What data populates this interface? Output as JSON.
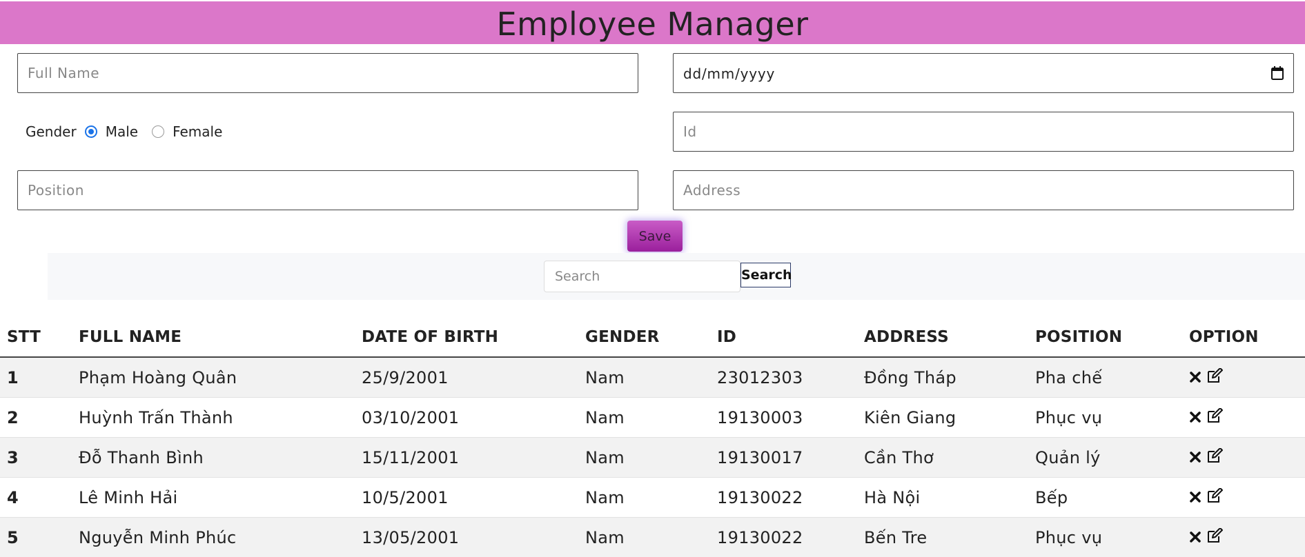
{
  "header": {
    "title": "Employee Manager"
  },
  "form": {
    "fullname_placeholder": "Full Name",
    "dob_placeholder": "dd/mm/yyyy",
    "gender_label": "Gender",
    "gender_options": [
      "Male",
      "Female"
    ],
    "gender_selected": "Male",
    "id_placeholder": "Id",
    "position_placeholder": "Position",
    "address_placeholder": "Address",
    "save_label": "Save"
  },
  "search": {
    "placeholder": "Search",
    "button_label": "Search"
  },
  "table": {
    "headers": [
      "STT",
      "FULL NAME",
      "DATE OF BIRTH",
      "GENDER",
      "ID",
      "ADDRESS",
      "POSITION",
      "OPTION"
    ],
    "rows": [
      {
        "stt": "1",
        "name": "Phạm Hoàng Quân",
        "dob": "25/9/2001",
        "gender": "Nam",
        "id": "23012303",
        "address": "Đồng Tháp",
        "position": "Pha chế"
      },
      {
        "stt": "2",
        "name": "Huỳnh Trấn Thành",
        "dob": "03/10/2001",
        "gender": "Nam",
        "id": "19130003",
        "address": "Kiên Giang",
        "position": "Phục vụ"
      },
      {
        "stt": "3",
        "name": "Đỗ Thanh Bình",
        "dob": "15/11/2001",
        "gender": "Nam",
        "id": "19130017",
        "address": "Cần Thơ",
        "position": "Quản lý"
      },
      {
        "stt": "4",
        "name": "Lê Minh Hải",
        "dob": "10/5/2001",
        "gender": "Nam",
        "id": "19130022",
        "address": "Hà Nội",
        "position": "Bếp"
      },
      {
        "stt": "5",
        "name": "Nguyễn Minh Phúc",
        "dob": "13/05/2001",
        "gender": "Nam",
        "id": "19130022",
        "address": "Bến Tre",
        "position": "Phục vụ"
      }
    ],
    "options": {
      "delete_icon": "x-icon",
      "edit_icon": "edit-icon"
    }
  },
  "colors": {
    "header_bg": "#db77c9",
    "save_bg": "#b13bb1",
    "radio_accent": "#1a73e8"
  }
}
